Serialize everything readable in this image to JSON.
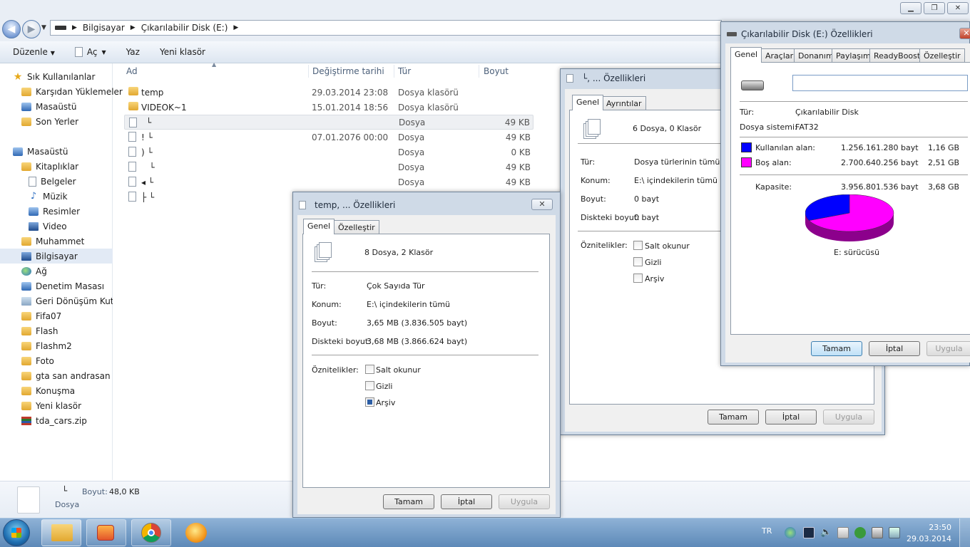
{
  "explorer": {
    "breadcrumb": [
      "Bilgisayar",
      "Çıkarılabilir Disk (E:)"
    ],
    "toolbar": {
      "organize": "Düzenle",
      "open": "Aç",
      "write": "Yaz",
      "new_folder": "Yeni klasör"
    },
    "nav": {
      "favorites_header": "Sık Kullanılanlar",
      "favorites": [
        "Karşıdan Yüklemeler",
        "Masaüstü",
        "Son Yerler"
      ],
      "desktop_header": "Masaüstü",
      "libraries": "Kitaplıklar",
      "library_items": [
        "Belgeler",
        "Müzik",
        "Resimler",
        "Video"
      ],
      "others": [
        "Muhammet",
        "Bilgisayar",
        "Ağ",
        "Denetim Masası",
        "Geri Dönüşüm Kutusu",
        "Fifa07",
        "Flash",
        "Flashm2",
        "Foto",
        "gta san andrasan",
        "Konuşma",
        "Yeni klasör",
        "tda_cars.zip"
      ]
    },
    "columns": {
      "name": "Ad",
      "date": "Değiştirme tarihi",
      "type": "Tür",
      "size": "Boyut"
    },
    "files": [
      {
        "name": "temp",
        "date": "29.03.2014 23:08",
        "type": "Dosya klasörü",
        "size": ""
      },
      {
        "name": "VIDEOK~1",
        "date": "15.01.2014 18:56",
        "type": "Dosya klasörü",
        "size": ""
      },
      {
        "name": "└",
        "date": "",
        "type": "Dosya",
        "size": "49 KB"
      },
      {
        "name": "! └",
        "date": "07.01.2076 00:00",
        "type": "Dosya",
        "size": "49 KB"
      },
      {
        "name": ") └",
        "date": "",
        "type": "Dosya",
        "size": "0 KB"
      },
      {
        "name": "   └",
        "date": "",
        "type": "Dosya",
        "size": "49 KB"
      },
      {
        "name": "◂ └",
        "date": "",
        "type": "Dosya",
        "size": "49 KB"
      },
      {
        "name": "├ └",
        "date": "",
        "type": "",
        "size": ""
      }
    ],
    "details": {
      "name": "└",
      "type": "Dosya",
      "size_label": "Boyut:",
      "size_value": "48,0 KB"
    }
  },
  "dialog_multi": {
    "title": "└, ... Özellikleri",
    "tabs": [
      "Genel",
      "Ayrıntılar"
    ],
    "summary": "6 Dosya, 0 Klasör",
    "type_label": "Tür:",
    "type_value": "Dosya türlerinin tümü",
    "location_label": "Konum:",
    "location_value": "E:\\ içindekilerin tümü",
    "size_label": "Boyut:",
    "size_value": "0 bayt",
    "disk_label": "Diskteki boyut:",
    "disk_value": "0 bayt",
    "attr_label": "Öznitelikler:",
    "attrs": [
      "Salt okunur",
      "Gizli",
      "Arşiv"
    ],
    "buttons": {
      "ok": "Tamam",
      "cancel": "İptal",
      "apply": "Uygula"
    }
  },
  "dialog_temp": {
    "title": "temp, ... Özellikleri",
    "tabs": [
      "Genel",
      "Özelleştir"
    ],
    "summary": "8 Dosya, 2 Klasör",
    "type_label": "Tür:",
    "type_value": "Çok Sayıda Tür",
    "location_label": "Konum:",
    "location_value": "E:\\ içindekilerin tümü",
    "size_label": "Boyut:",
    "size_value": "3,65 MB (3.836.505 bayt)",
    "disk_label": "Diskteki boyut:",
    "disk_value": "3,68 MB (3.866.624 bayt)",
    "attr_label": "Öznitelikler:",
    "attrs": [
      "Salt okunur",
      "Gizli",
      "Arşiv"
    ],
    "buttons": {
      "ok": "Tamam",
      "cancel": "İptal",
      "apply": "Uygula"
    }
  },
  "dialog_disk": {
    "title": "Çıkarılabilir Disk (E:) Özellikleri",
    "tabs": [
      "Genel",
      "Araçlar",
      "Donanım",
      "Paylaşım",
      "ReadyBoost",
      "Özelleştir"
    ],
    "label_value": "",
    "type_label": "Tür:",
    "type_value": "Çıkarılabilir Disk",
    "fs_label": "Dosya sistemi:",
    "fs_value": "FAT32",
    "used_label": "Kullanılan alan:",
    "used_bytes": "1.256.161.280 bayt",
    "used_gb": "1,16 GB",
    "free_label": "Boş alan:",
    "free_bytes": "2.700.640.256 bayt",
    "free_gb": "2,51 GB",
    "cap_label": "Kapasite:",
    "cap_bytes": "3.956.801.536 bayt",
    "cap_gb": "3,68 GB",
    "drive_caption": "E: sürücüsü",
    "used_color": "#0000ff",
    "free_color": "#ff00ff",
    "used_fraction": 0.317,
    "buttons": {
      "ok": "Tamam",
      "cancel": "İptal",
      "apply": "Uygula"
    }
  },
  "taskbar": {
    "lang": "TR",
    "time": "23:50",
    "date": "29.03.2014"
  }
}
